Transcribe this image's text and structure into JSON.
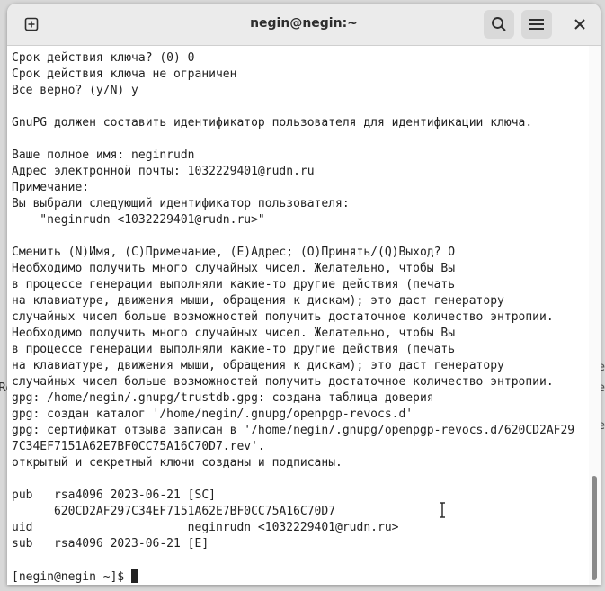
{
  "window": {
    "title": "negin@negin:~"
  },
  "background": {
    "left_text": "Re",
    "right_texts": [
      "le",
      "le",
      "le"
    ]
  },
  "icons": {
    "new_tab": "new-tab-icon",
    "search": "search-icon",
    "menu": "hamburger-menu-icon",
    "close": "close-icon"
  },
  "terminal": {
    "lines": [
      "Срок действия ключа? (0) 0",
      "Срок действия ключа не ограничен",
      "Все верно? (y/N) y",
      "",
      "GnuPG должен составить идентификатор пользователя для идентификации ключа.",
      "",
      "Ваше полное имя: neginrudn",
      "Адрес электронной почты: 1032229401@rudn.ru",
      "Примечание:",
      "Вы выбрали следующий идентификатор пользователя:",
      "    \"neginrudn <1032229401@rudn.ru>\"",
      "",
      "Сменить (N)Имя, (C)Примечание, (E)Адрес; (O)Принять/(Q)Выход? O",
      "Необходимо получить много случайных чисел. Желательно, чтобы Вы",
      "в процессе генерации выполняли какие-то другие действия (печать",
      "на клавиатуре, движения мыши, обращения к дискам); это даст генератору",
      "случайных чисел больше возможностей получить достаточное количество энтропии.",
      "Необходимо получить много случайных чисел. Желательно, чтобы Вы",
      "в процессе генерации выполняли какие-то другие действия (печать",
      "на клавиатуре, движения мыши, обращения к дискам); это даст генератору",
      "случайных чисел больше возможностей получить достаточное количество энтропии.",
      "gpg: /home/negin/.gnupg/trustdb.gpg: создана таблица доверия",
      "gpg: создан каталог '/home/negin/.gnupg/openpgp-revocs.d'",
      "gpg: сертификат отзыва записан в '/home/negin/.gnupg/openpgp-revocs.d/620CD2AF29",
      "7C34EF7151A62E7BF0CC75A16C70D7.rev'.",
      "открытый и секретный ключи созданы и подписаны.",
      "",
      "pub   rsa4096 2023-06-21 [SC]",
      "      620CD2AF297C34EF7151A62E7BF0CC75A16C70D7",
      "uid                      neginrudn <1032229401@rudn.ru>",
      "sub   rsa4096 2023-06-21 [E]",
      ""
    ],
    "prompt": "[negin@negin ~]$ "
  }
}
